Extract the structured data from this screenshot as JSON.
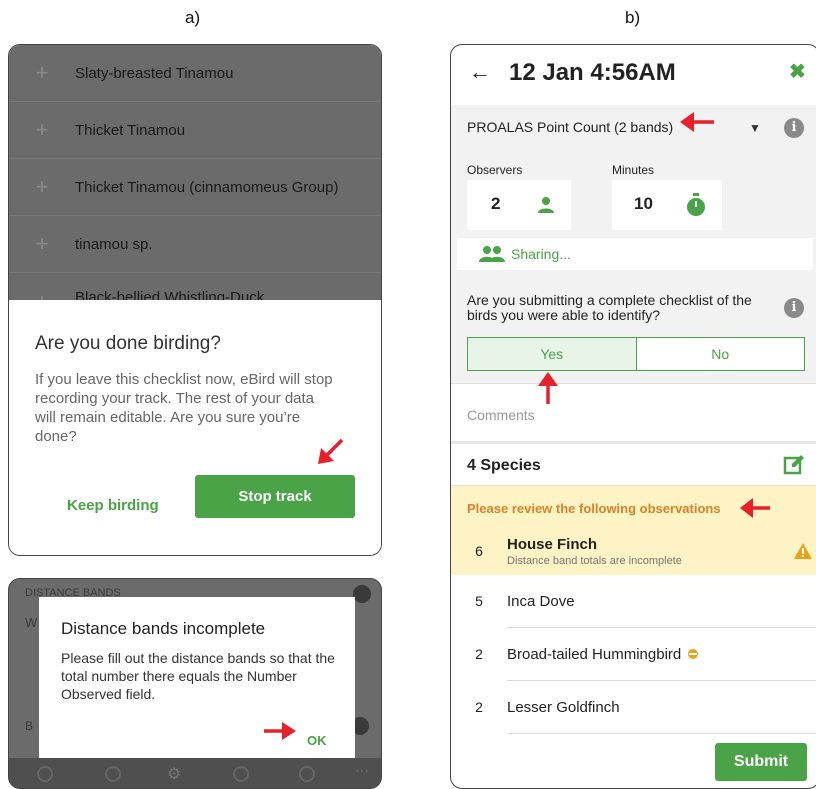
{
  "labels": {
    "a": "a)",
    "b": "b)"
  },
  "panel_a": {
    "species_list": [
      "Slaty-breasted Tinamou",
      "Thicket Tinamou",
      "Thicket Tinamou (cinnamomeus Group)",
      "tinamou sp.",
      "Black-bellied Whistling-Duck"
    ],
    "done_dialog": {
      "title": "Are you done birding?",
      "body": "If you leave this checklist now, eBird will stop recording your track. The rest of your data will remain editable. Are you sure you’re done?",
      "keep_label": "Keep birding",
      "stop_label": "Stop track"
    },
    "bands_screen": {
      "bg_header": "DISTANCE BANDS",
      "bg_w": "W",
      "bg_b": "B"
    },
    "bands_dialog": {
      "title": "Distance bands incomplete",
      "body": "Please fill out the distance bands so that the total number there equals the Number Observed field.",
      "ok_label": "OK"
    }
  },
  "panel_b": {
    "header": {
      "title": "12 Jan 4:56AM"
    },
    "protocol": "PROALAS Point Count (2 bands)",
    "observers": {
      "label": "Observers",
      "value": "2"
    },
    "minutes": {
      "label": "Minutes",
      "value": "10"
    },
    "sharing": "Sharing...",
    "complete_question": "Are you submitting a complete checklist of the birds you were able to identify?",
    "yes_label": "Yes",
    "no_label": "No",
    "comments_placeholder": "Comments",
    "species_count": "4 Species",
    "review_banner": "Please review the following observations",
    "observations": [
      {
        "count": "6",
        "name": "House Finch",
        "note": "Distance band totals are incomplete"
      },
      {
        "count": "5",
        "name": "Inca Dove"
      },
      {
        "count": "2",
        "name": "Broad-tailed Hummingbird"
      },
      {
        "count": "2",
        "name": "Lesser Goldfinch"
      }
    ],
    "submit_label": "Submit"
  },
  "colors": {
    "green": "#4aa347",
    "red_arrow": "#e8202a",
    "review_text": "#d9822b",
    "review_bg": "#fdf3c4",
    "warning": "#e8a317"
  }
}
